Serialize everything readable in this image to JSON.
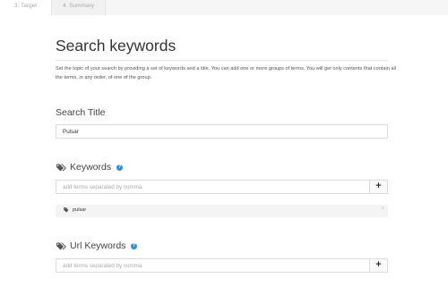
{
  "tabs": [
    {
      "label": "3. Target"
    },
    {
      "label": "4. Summary"
    }
  ],
  "page": {
    "title": "Search keywords",
    "description": "Set the topic of your search by providing a set of keywords and a title. You can add one or more groups of terms. You will get only contents that contain all the terms, in any order, of one of the group."
  },
  "search_title": {
    "label": "Search Title",
    "value": "Pulsar"
  },
  "keywords": {
    "label": "Keywords",
    "help": "?",
    "placeholder": "add terms separated by comma",
    "add_label": "+",
    "tags": [
      {
        "text": "pulsar",
        "remove": "×"
      }
    ]
  },
  "url_keywords": {
    "label": "Url Keywords",
    "help": "?",
    "placeholder": "add terms separated by comma",
    "add_label": "+"
  },
  "icons": {
    "tags": "tags-icon",
    "tag": "tag-icon",
    "help": "question-icon"
  },
  "colors": {
    "accent": "#2f8fd0"
  }
}
